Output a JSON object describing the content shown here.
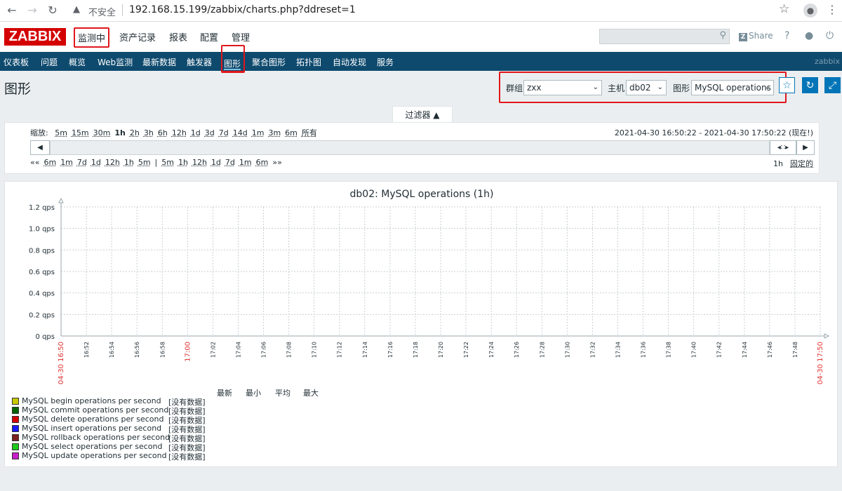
{
  "browser": {
    "insecure_label": "不安全",
    "url": "192.168.15.199/zabbix/charts.php?ddreset=1"
  },
  "header": {
    "logo": "ZABBIX",
    "menu": [
      "监测中",
      "资产记录",
      "报表",
      "配置",
      "管理"
    ],
    "share_label": "Share",
    "help_icon": "?"
  },
  "subnav": {
    "items": [
      "仪表板",
      "问题",
      "概览",
      "Web监测",
      "最新数据",
      "触发器",
      "图形",
      "聚合图形",
      "拓扑图",
      "自动发现",
      "服务"
    ],
    "active": "图形",
    "brand": "zabbix"
  },
  "page": {
    "title": "图形",
    "group_label": "群组",
    "group_value": "zxx",
    "host_label": "主机",
    "host_value": "db02",
    "graph_label": "图形",
    "graph_value": "MySQL operations"
  },
  "filter": {
    "tab_label": "过滤器 ▲",
    "zoom_label": "缩放:",
    "zoom_options": [
      "5m",
      "15m",
      "30m",
      "1h",
      "2h",
      "3h",
      "6h",
      "12h",
      "1d",
      "3d",
      "7d",
      "14d",
      "1m",
      "3m",
      "6m",
      "所有"
    ],
    "zoom_active": "1h",
    "time_range": "2021-04-30 16:50:22 - 2021-04-30 17:50:22 (现在!)",
    "shift_back": [
      "6m",
      "1m",
      "7d",
      "1d",
      "12h",
      "1h",
      "5m"
    ],
    "shift_forward": [
      "5m",
      "1h",
      "12h",
      "1d",
      "7d",
      "1m",
      "6m"
    ],
    "period": "1h",
    "fixed_label": "固定的"
  },
  "chart_data": {
    "type": "line",
    "title": "db02: MySQL operations (1h)",
    "y_ticks": [
      "0 qps",
      "0.2 qps",
      "0.4 qps",
      "0.6 qps",
      "0.8 qps",
      "1.0 qps",
      "1.2 qps"
    ],
    "ylim": [
      0,
      1.2
    ],
    "y_unit": "qps",
    "x_start_label": "04-30 16:50",
    "x_end_label": "04-30 17:50",
    "x_ticks": [
      "16:52",
      "16:54",
      "16:56",
      "16:58",
      "17:00",
      "17:02",
      "17:04",
      "17:06",
      "17:08",
      "17:10",
      "17:12",
      "17:14",
      "17:16",
      "17:18",
      "17:20",
      "17:22",
      "17:24",
      "17:26",
      "17:28",
      "17:30",
      "17:32",
      "17:34",
      "17:36",
      "17:38",
      "17:40",
      "17:42",
      "17:44",
      "17:46",
      "17:48"
    ],
    "highlight_tick": "17:00",
    "grid": true,
    "series": [
      {
        "name": "MySQL begin operations per second",
        "color": "#c8c800",
        "values": []
      },
      {
        "name": "MySQL commit operations per second",
        "color": "#006400",
        "values": []
      },
      {
        "name": "MySQL delete operations per second",
        "color": "#d40000",
        "values": []
      },
      {
        "name": "MySQL insert operations per second",
        "color": "#1a1aff",
        "values": []
      },
      {
        "name": "MySQL rollback operations per second",
        "color": "#7a2020",
        "values": []
      },
      {
        "name": "MySQL select operations per second",
        "color": "#1ec81e",
        "values": []
      },
      {
        "name": "MySQL update operations per second",
        "color": "#c81ec8",
        "values": []
      }
    ],
    "legend_headers": [
      "最新",
      "最小",
      "平均",
      "最大"
    ],
    "no_data_label": "[没有数据]"
  }
}
